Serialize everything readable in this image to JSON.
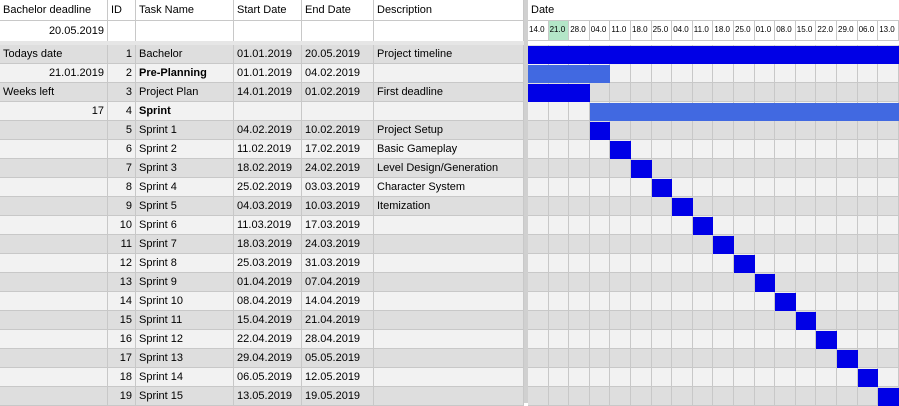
{
  "header": {
    "bachelor_deadline_label": "Bachelor deadline",
    "bachelor_deadline_value": "20.05.2019",
    "id": "ID",
    "task_name": "Task Name",
    "start_date": "Start Date",
    "end_date": "End Date",
    "description": "Description",
    "date": "Date"
  },
  "side": {
    "todays_date_label": "Todays date",
    "todays_date_value": "21.01.2019",
    "weeks_left_label": "Weeks left",
    "weeks_left_value": "17"
  },
  "timeline_dates": [
    "14.0",
    "21.0",
    "28.0",
    "04.0",
    "11.0",
    "18.0",
    "25.0",
    "04.0",
    "11.0",
    "18.0",
    "25.0",
    "01.0",
    "08.0",
    "15.0",
    "22.0",
    "29.0",
    "06.0",
    "13.0"
  ],
  "highlight_date_index": 1,
  "colors": {
    "bar_dark": "#0000e6",
    "bar_light": "#4169e1",
    "today_highlight": "#b4e6c8"
  },
  "tasks": [
    {
      "id": "1",
      "name": "Bachelor",
      "start": "01.01.2019",
      "end": "20.05.2019",
      "desc": "Project timeline",
      "bold": false,
      "style": "dark",
      "bar_start": 0,
      "bar_span": 18
    },
    {
      "id": "2",
      "name": "Pre-Planning",
      "start": "01.01.2019",
      "end": "04.02.2019",
      "desc": "",
      "bold": true,
      "style": "light",
      "bar_start": 0,
      "bar_span": 4
    },
    {
      "id": "3",
      "name": "Project Plan",
      "start": "14.01.2019",
      "end": "01.02.2019",
      "desc": "First deadline",
      "bold": false,
      "style": "dark",
      "bar_start": 0,
      "bar_span": 3
    },
    {
      "id": "4",
      "name": "Sprint",
      "start": "",
      "end": "",
      "desc": "",
      "bold": true,
      "style": "light",
      "bar_start": 3,
      "bar_span": 15
    },
    {
      "id": "5",
      "name": "Sprint 1",
      "start": "04.02.2019",
      "end": "10.02.2019",
      "desc": "Project Setup",
      "bold": false,
      "style": "dark",
      "bar_start": 3,
      "bar_span": 1
    },
    {
      "id": "6",
      "name": "Sprint 2",
      "start": "11.02.2019",
      "end": "17.02.2019",
      "desc": "Basic Gameplay",
      "bold": false,
      "style": "dark",
      "bar_start": 4,
      "bar_span": 1
    },
    {
      "id": "7",
      "name": "Sprint 3",
      "start": "18.02.2019",
      "end": "24.02.2019",
      "desc": "Level Design/Generation",
      "bold": false,
      "style": "dark",
      "bar_start": 5,
      "bar_span": 1
    },
    {
      "id": "8",
      "name": "Sprint 4",
      "start": "25.02.2019",
      "end": "03.03.2019",
      "desc": "Character System",
      "bold": false,
      "style": "dark",
      "bar_start": 6,
      "bar_span": 1
    },
    {
      "id": "9",
      "name": "Sprint 5",
      "start": "04.03.2019",
      "end": "10.03.2019",
      "desc": "Itemization",
      "bold": false,
      "style": "dark",
      "bar_start": 7,
      "bar_span": 1
    },
    {
      "id": "10",
      "name": "Sprint 6",
      "start": "11.03.2019",
      "end": "17.03.2019",
      "desc": "",
      "bold": false,
      "style": "dark",
      "bar_start": 8,
      "bar_span": 1
    },
    {
      "id": "11",
      "name": "Sprint 7",
      "start": "18.03.2019",
      "end": "24.03.2019",
      "desc": "",
      "bold": false,
      "style": "dark",
      "bar_start": 9,
      "bar_span": 1
    },
    {
      "id": "12",
      "name": "Sprint 8",
      "start": "25.03.2019",
      "end": "31.03.2019",
      "desc": "",
      "bold": false,
      "style": "dark",
      "bar_start": 10,
      "bar_span": 1
    },
    {
      "id": "13",
      "name": "Sprint 9",
      "start": "01.04.2019",
      "end": "07.04.2019",
      "desc": "",
      "bold": false,
      "style": "dark",
      "bar_start": 11,
      "bar_span": 1
    },
    {
      "id": "14",
      "name": "Sprint 10",
      "start": "08.04.2019",
      "end": "14.04.2019",
      "desc": "",
      "bold": false,
      "style": "dark",
      "bar_start": 12,
      "bar_span": 1
    },
    {
      "id": "15",
      "name": "Sprint 11",
      "start": "15.04.2019",
      "end": "21.04.2019",
      "desc": "",
      "bold": false,
      "style": "dark",
      "bar_start": 13,
      "bar_span": 1
    },
    {
      "id": "16",
      "name": "Sprint 12",
      "start": "22.04.2019",
      "end": "28.04.2019",
      "desc": "",
      "bold": false,
      "style": "dark",
      "bar_start": 14,
      "bar_span": 1
    },
    {
      "id": "17",
      "name": "Sprint 13",
      "start": "29.04.2019",
      "end": "05.05.2019",
      "desc": "",
      "bold": false,
      "style": "dark",
      "bar_start": 15,
      "bar_span": 1
    },
    {
      "id": "18",
      "name": "Sprint 14",
      "start": "06.05.2019",
      "end": "12.05.2019",
      "desc": "",
      "bold": false,
      "style": "dark",
      "bar_start": 16,
      "bar_span": 1
    },
    {
      "id": "19",
      "name": "Sprint 15",
      "start": "13.05.2019",
      "end": "19.05.2019",
      "desc": "",
      "bold": false,
      "style": "dark",
      "bar_start": 17,
      "bar_span": 1
    }
  ]
}
